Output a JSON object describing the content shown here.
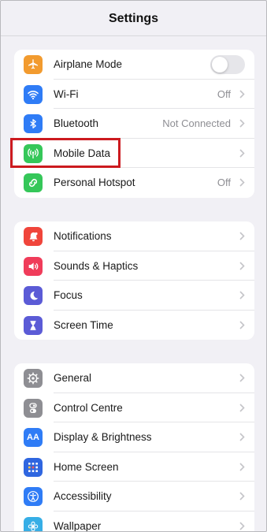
{
  "header": {
    "title": "Settings"
  },
  "colors": {
    "airplane": "#f29b2f",
    "wifi": "#2f7cf6",
    "bluetooth": "#2f7cf6",
    "mobile": "#35c759",
    "hotspot": "#35c759",
    "notifications": "#f0453b",
    "sounds": "#f03c5a",
    "focus": "#5b5bd6",
    "screentime": "#5b5bd6",
    "general": "#8e8e93",
    "control": "#8e8e93",
    "display": "#2f7cf6",
    "home": "#2f66e0",
    "accessibility": "#2f7cf6",
    "wallpaper": "#36aee6",
    "highlight": "#cc1a1f"
  },
  "group1": {
    "airplane": {
      "label": "Airplane Mode",
      "icon": "airplane-icon"
    },
    "wifi": {
      "label": "Wi-Fi",
      "value": "Off",
      "icon": "wifi-icon"
    },
    "bluetooth": {
      "label": "Bluetooth",
      "value": "Not Connected",
      "icon": "bluetooth-icon"
    },
    "mobile": {
      "label": "Mobile Data",
      "icon": "antenna-icon"
    },
    "hotspot": {
      "label": "Personal Hotspot",
      "value": "Off",
      "icon": "hotspot-icon"
    }
  },
  "group2": {
    "notifications": {
      "label": "Notifications",
      "icon": "bell-icon"
    },
    "sounds": {
      "label": "Sounds & Haptics",
      "icon": "speaker-icon"
    },
    "focus": {
      "label": "Focus",
      "icon": "moon-icon"
    },
    "screentime": {
      "label": "Screen Time",
      "icon": "hourglass-icon"
    }
  },
  "group3": {
    "general": {
      "label": "General",
      "icon": "gear-icon"
    },
    "control": {
      "label": "Control Centre",
      "icon": "toggles-icon"
    },
    "display": {
      "label": "Display & Brightness",
      "icon": "text-size-icon",
      "glyph": "AA"
    },
    "home": {
      "label": "Home Screen",
      "icon": "app-grid-icon"
    },
    "accessibility": {
      "label": "Accessibility",
      "icon": "accessibility-icon"
    },
    "wallpaper": {
      "label": "Wallpaper",
      "icon": "flower-icon"
    }
  }
}
